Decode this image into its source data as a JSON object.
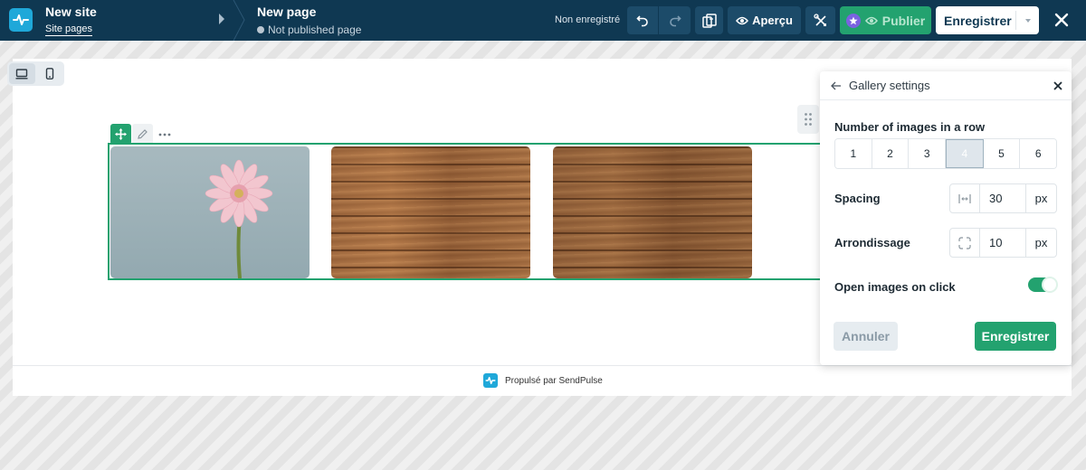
{
  "topbar": {
    "site_title": "New site",
    "site_pages_link": "Site pages",
    "page_title": "New page",
    "page_status": "Not published page",
    "unsaved_text": "Non enregistré",
    "preview_label": "Aperçu",
    "publish_label": "Publier",
    "save_label": "Enregistrer"
  },
  "footer": {
    "powered_by": "Propulsé par SendPulse"
  },
  "gallery_settings": {
    "title": "Gallery settings",
    "images_per_row_label": "Number of images in a row",
    "images_per_row_options": [
      "1",
      "2",
      "3",
      "4",
      "5",
      "6"
    ],
    "images_per_row_selected": "4",
    "spacing_label": "Spacing",
    "spacing_value": "30",
    "spacing_unit": "px",
    "radius_label": "Arrondissage",
    "radius_value": "10",
    "radius_unit": "px",
    "open_on_click_label": "Open images on click",
    "open_on_click_enabled": true,
    "cancel_label": "Annuler",
    "save_label": "Enregistrer"
  },
  "colors": {
    "topbar_bg": "#0f3852",
    "accent_green": "#23a26f",
    "brand_blue": "#1fa8d9"
  },
  "icons": {
    "logo": "sendpulse-pulse-icon",
    "undo": "undo-icon",
    "redo": "redo-icon",
    "copy": "copy-pages-icon",
    "preview": "eye-icon",
    "tools": "tools-icon",
    "premium": "star-badge-icon",
    "close": "close-icon"
  }
}
